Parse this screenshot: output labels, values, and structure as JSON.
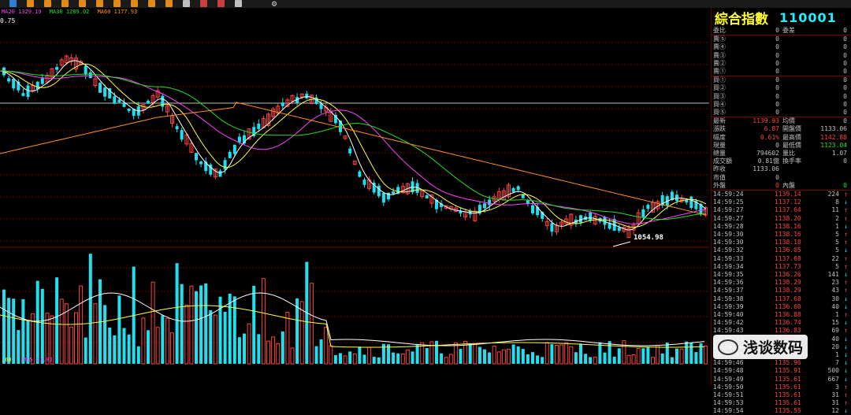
{
  "toolbar": {
    "icons": [
      "stock-icon",
      "number-1-icon",
      "number-2-icon",
      "number-3-icon",
      "number-4-icon",
      "number-5-icon",
      "number-6-icon",
      "number-7-icon",
      "number-8-icon",
      "number-9-icon",
      "tool-icon",
      "pen-icon",
      "clear-icon",
      "note-icon",
      "gear-icon"
    ]
  },
  "chart": {
    "ma_legend": {
      "ma20": "MA20 1329.19",
      "ma30": "MA30 1289.02",
      "ma60": "MA60 1177.93"
    },
    "top_price": "0.75",
    "low_price": "1054.98",
    "vol_legend": {
      "left": ".60",
      "ma": "MA5 11.82"
    }
  },
  "quote": {
    "title": "綜合指數",
    "code": "110001",
    "header_rows": [
      {
        "l": "委比",
        "v": "0",
        "l2": "委差",
        "v2": "0"
      },
      {
        "l": "賣⑤",
        "v": "0",
        "l2": "",
        "v2": "0"
      },
      {
        "l": "賣④",
        "v": "0",
        "l2": "",
        "v2": "0"
      },
      {
        "l": "賣③",
        "v": "0",
        "l2": "",
        "v2": "0"
      },
      {
        "l": "賣②",
        "v": "0",
        "l2": "",
        "v2": "0"
      },
      {
        "l": "賣①",
        "v": "0",
        "l2": "",
        "v2": "0"
      },
      {
        "l": "買①",
        "v": "0",
        "l2": "",
        "v2": "0"
      },
      {
        "l": "買②",
        "v": "0",
        "l2": "",
        "v2": "0"
      },
      {
        "l": "買③",
        "v": "0",
        "l2": "",
        "v2": "0"
      },
      {
        "l": "買④",
        "v": "0",
        "l2": "",
        "v2": "0"
      },
      {
        "l": "買⑤",
        "v": "0",
        "l2": "",
        "v2": "0"
      }
    ],
    "stats_rows": [
      {
        "l": "最新",
        "v": "1139.93",
        "vc": "#ff4040",
        "l2": "均價",
        "v2": "0",
        "v2c": "#c0c0c0"
      },
      {
        "l": "漲跌",
        "v": "6.87",
        "vc": "#ff4040",
        "l2": "開盤價",
        "v2": "1133.06",
        "v2c": "#c0c0c0"
      },
      {
        "l": "幅度",
        "v": "0.61%",
        "vc": "#ff4040",
        "l2": "最高價",
        "v2": "1142.88",
        "v2c": "#ff4040"
      },
      {
        "l": "現量",
        "v": "0",
        "vc": "#c0c0c0",
        "l2": "最低價",
        "v2": "1123.04",
        "v2c": "#20e020"
      },
      {
        "l": "總量",
        "v": "794602",
        "vc": "#c0c0c0",
        "l2": "量比",
        "v2": "1.07",
        "v2c": "#c0c0c0"
      },
      {
        "l": "成交額",
        "v": "0.81億",
        "vc": "#c0c0c0",
        "l2": "換手率",
        "v2": "0",
        "v2c": "#c0c0c0"
      },
      {
        "l": "昨收",
        "v": "1133.06",
        "vc": "#c0c0c0",
        "l2": "",
        "v2": "",
        "v2c": "#c0c0c0"
      },
      {
        "l": "市值",
        "v": "0",
        "vc": "#c0c0c0",
        "l2": "",
        "v2": "",
        "v2c": "#c0c0c0"
      },
      {
        "l": "外盤",
        "v": "0",
        "vc": "#ff4040",
        "l2": "內盤",
        "v2": "0",
        "v2c": "#20e020"
      }
    ],
    "ticks": [
      {
        "t": "14:59:24",
        "p": "1139.14",
        "v": "224",
        "d": "up"
      },
      {
        "t": "14:59:25",
        "p": "1137.12",
        "v": "8",
        "d": "dn"
      },
      {
        "t": "14:59:27",
        "p": "1137.64",
        "v": "11",
        "d": "up"
      },
      {
        "t": "14:59:27",
        "p": "1138.20",
        "v": "2",
        "d": "up"
      },
      {
        "t": "14:59:28",
        "p": "1138.16",
        "v": "1",
        "d": "dn"
      },
      {
        "t": "14:59:30",
        "p": "1138.16",
        "v": "5",
        "d": "up"
      },
      {
        "t": "14:59:30",
        "p": "1138.18",
        "v": "5",
        "d": "up"
      },
      {
        "t": "14:59:32",
        "p": "1136.05",
        "v": "5",
        "d": "dn"
      },
      {
        "t": "14:59:33",
        "p": "1137.68",
        "v": "22",
        "d": "up"
      },
      {
        "t": "14:59:34",
        "p": "1137.73",
        "v": "5",
        "d": "up"
      },
      {
        "t": "14:59:35",
        "p": "1136.26",
        "v": "141",
        "d": "dn"
      },
      {
        "t": "14:59:36",
        "p": "1138.29",
        "v": "23",
        "d": "up"
      },
      {
        "t": "14:59:37",
        "p": "1138.29",
        "v": "43",
        "d": "up"
      },
      {
        "t": "14:59:38",
        "p": "1137.68",
        "v": "30",
        "d": "dn"
      },
      {
        "t": "14:59:39",
        "p": "1136.60",
        "v": "40",
        "d": "dn"
      },
      {
        "t": "14:59:40",
        "p": "1136.88",
        "v": "1",
        "d": "up"
      },
      {
        "t": "14:59:42",
        "p": "1136.74",
        "v": "15",
        "d": "dn"
      },
      {
        "t": "14:59:43",
        "p": "1136.83",
        "v": "69",
        "d": "up"
      },
      {
        "t": "14:59:43",
        "p": "1136.71",
        "v": "40",
        "d": "dn"
      },
      {
        "t": "14:59:44",
        "p": "1136.33",
        "v": "20",
        "d": "dn"
      },
      {
        "t": "14:59:45",
        "p": "1136.28",
        "v": "1",
        "d": "dn"
      },
      {
        "t": "14:59:46",
        "p": "1135.96",
        "v": "7",
        "d": "dn"
      },
      {
        "t": "14:59:48",
        "p": "1135.91",
        "v": "500",
        "d": "dn"
      },
      {
        "t": "14:59:49",
        "p": "1135.61",
        "v": "667",
        "d": "dn"
      },
      {
        "t": "14:59:50",
        "p": "1135.61",
        "v": "3",
        "d": "up"
      },
      {
        "t": "14:59:51",
        "p": "1135.61",
        "v": "31",
        "d": "up"
      },
      {
        "t": "14:59:53",
        "p": "1135.61",
        "v": "31",
        "d": "up"
      },
      {
        "t": "14:59:54",
        "p": "1135.55",
        "v": "12",
        "d": "dn"
      }
    ]
  },
  "watermark": {
    "text": "浅谈数码"
  },
  "colors": {
    "up": "#ff4040",
    "down": "#20e0f0",
    "ma_white": "#ffffff",
    "ma_yellow": "#ffff40",
    "ma_magenta": "#ff40ff",
    "ma_green": "#20e020",
    "ma_orange": "#ff9020"
  }
}
